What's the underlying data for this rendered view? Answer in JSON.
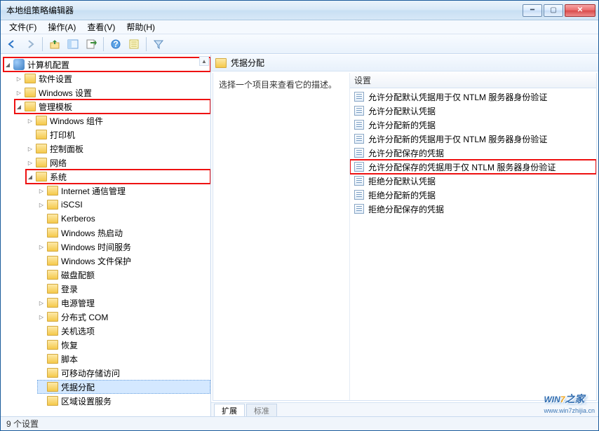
{
  "window": {
    "title": "本地组策略编辑器"
  },
  "menu": {
    "file": "文件(F)",
    "action": "操作(A)",
    "view": "查看(V)",
    "help": "帮助(H)"
  },
  "toolbar_icons": {
    "back": "back-arrow-icon",
    "forward": "forward-arrow-icon",
    "up": "up-level-icon",
    "showhide": "showhide-tree-icon",
    "export": "export-list-icon",
    "help": "help-icon",
    "properties": "properties-icon",
    "filter": "filter-icon"
  },
  "tree": {
    "root": "计算机配置",
    "n_software": "软件设置",
    "n_windows_settings": "Windows 设置",
    "n_admin_templates": "管理模板",
    "n_windows_components": "Windows 组件",
    "n_printers": "打印机",
    "n_control_panel": "控制面板",
    "n_network": "网络",
    "n_system": "系统",
    "n_internet_comm": "Internet 通信管理",
    "n_iscsi": "iSCSI",
    "n_kerberos": "Kerberos",
    "n_windows_hotstart": "Windows 热启动",
    "n_windows_time": "Windows 时间服务",
    "n_windows_fileprotect": "Windows 文件保护",
    "n_disk_quota": "磁盘配额",
    "n_logon": "登录",
    "n_power": "电源管理",
    "n_dcom": "分布式 COM",
    "n_shutdown_options": "关机选项",
    "n_recovery": "恢复",
    "n_scripts": "脚本",
    "n_removable_storage": "可移动存储访问",
    "n_cred_delegation": "凭据分配",
    "n_locale_services": "区域设置服务"
  },
  "right": {
    "heading": "凭据分配",
    "desc": "选择一个项目来查看它的描述。",
    "col_setting": "设置",
    "items": [
      {
        "label": "允许分配默认凭据用于仅 NTLM 服务器身份验证"
      },
      {
        "label": "允许分配默认凭据"
      },
      {
        "label": "允许分配新的凭据"
      },
      {
        "label": "允许分配新的凭据用于仅 NTLM 服务器身份验证"
      },
      {
        "label": "允许分配保存的凭据"
      },
      {
        "label": "允许分配保存的凭据用于仅 NTLM 服务器身份验证",
        "highlight": true
      },
      {
        "label": "拒绝分配默认凭据"
      },
      {
        "label": "拒绝分配新的凭据"
      },
      {
        "label": "拒绝分配保存的凭据"
      }
    ]
  },
  "tabs": {
    "extended": "扩展",
    "standard": "标准"
  },
  "statusbar": "9 个设置",
  "watermark": {
    "logo1": "WIN",
    "logo2": "7",
    "logo3": "之家",
    "sub": "www.win7zhijia.cn"
  }
}
